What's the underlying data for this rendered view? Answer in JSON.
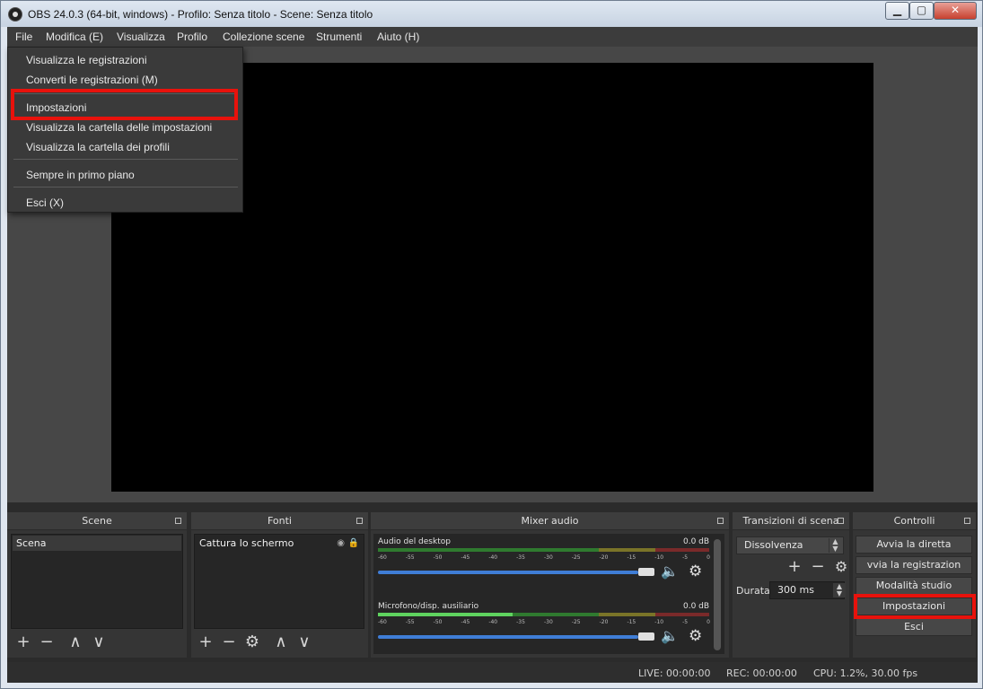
{
  "window": {
    "title": "OBS 24.0.3 (64-bit, windows) - Profilo: Senza titolo - Scene: Senza titolo",
    "min_glyph": "▁",
    "max_glyph": "▢",
    "close_glyph": "✕"
  },
  "menubar": {
    "items": [
      "File",
      "Modifica (E)",
      "Visualizza",
      "Profilo",
      "Collezione scene",
      "Strumenti",
      "Aiuto (H)"
    ]
  },
  "file_menu": {
    "items": [
      "Visualizza le registrazioni",
      "Converti le registrazioni (M)",
      "Impostazioni",
      "Visualizza la cartella delle impostazioni",
      "Visualizza la cartella dei profili",
      "Sempre in primo piano",
      "Esci (X)"
    ]
  },
  "docks": {
    "scene": {
      "title": "Scene",
      "items": [
        "Scena"
      ]
    },
    "fonti": {
      "title": "Fonti",
      "items": [
        "Cattura lo schermo"
      ]
    },
    "mixer": {
      "title": "Mixer audio",
      "tracks": [
        {
          "name": "Audio del desktop",
          "db": "0.0 dB",
          "level": 0.82
        },
        {
          "name": "Microfono/disp. ausiliario",
          "db": "0.0 dB",
          "level": 0.82
        }
      ],
      "ticks": [
        "-60",
        "-55",
        "-50",
        "-45",
        "-40",
        "-35",
        "-30",
        "-25",
        "-20",
        "-15",
        "-10",
        "-5",
        "0"
      ]
    },
    "transizioni": {
      "title": "Transizioni di scena",
      "transition": "Dissolvenza",
      "duration_label": "Durata",
      "duration_value": "300 ms"
    },
    "controlli": {
      "title": "Controlli",
      "buttons": [
        "Avvia la diretta",
        "vvia la registrazion",
        "Modalità studio",
        "Impostazioni",
        "Esci"
      ]
    }
  },
  "status": {
    "live": "LIVE: 00:00:00",
    "rec": "REC: 00:00:00",
    "cpu": "CPU: 1.2%, 30.00 fps"
  },
  "icons": {
    "plus": "+",
    "minus": "−",
    "up": "∧",
    "down": "∨",
    "gear": "⚙",
    "speaker": "🔈",
    "eye": "◉",
    "lock": "🔒"
  },
  "colors": {
    "highlight": "#e8120c",
    "slider": "#3f7dd6"
  }
}
